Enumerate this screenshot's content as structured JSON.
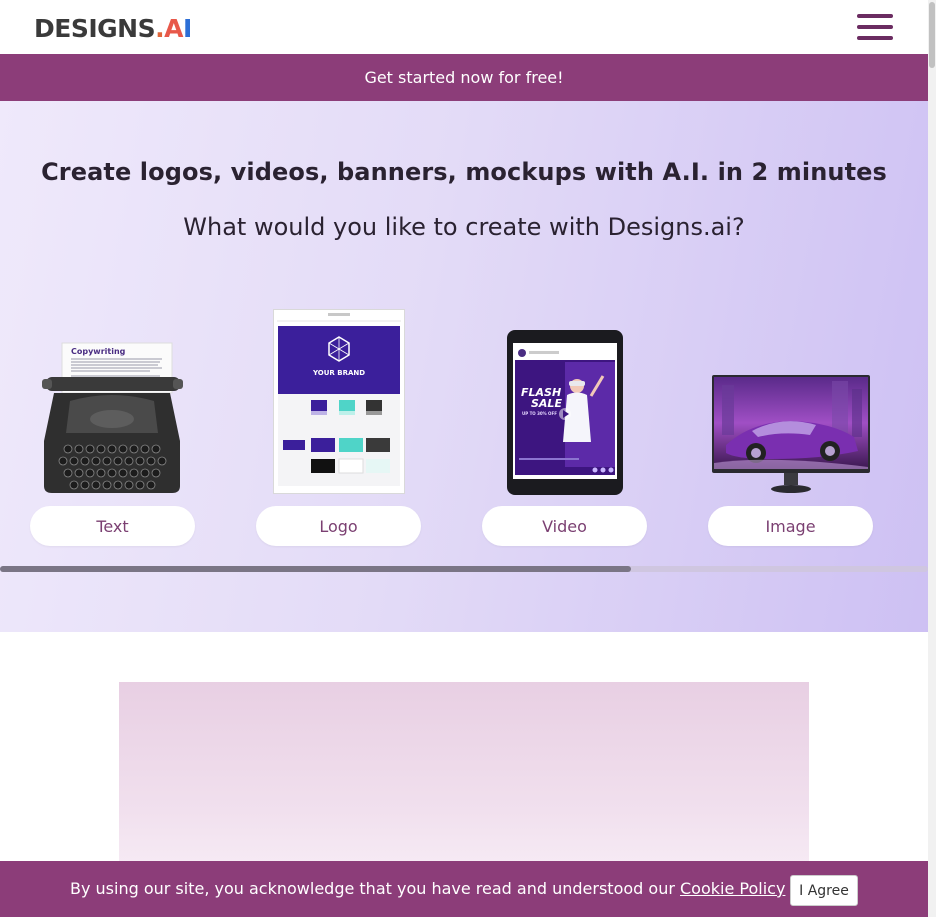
{
  "header": {
    "logo": {
      "main": "DESIGNS",
      "dot": ".",
      "a": "A",
      "i": "I"
    },
    "menu_icon": "hamburger-menu-icon"
  },
  "promo": {
    "text": "Get started now for free!"
  },
  "hero": {
    "title": "Create logos, videos, banners, mockups with A.I. in 2 minutes",
    "subtitle": "What would you like to create with Designs.ai?",
    "cards": [
      {
        "label": "Text",
        "image": "typewriter-image",
        "sheet_title": "Copywriting"
      },
      {
        "label": "Logo",
        "image": "brand-guide-image",
        "brand_text": "YOUR BRAND"
      },
      {
        "label": "Video",
        "image": "tablet-video-image",
        "flash": "FLASH",
        "sale": "SALE",
        "offer": "UP TO 30% OFF"
      },
      {
        "label": "Image",
        "image": "monitor-car-image"
      }
    ],
    "scroll_position": 0.68
  },
  "cookie": {
    "text": "By using our site, you acknowledge that you have read and understood our ",
    "link": "Cookie Policy",
    "button": "I Agree"
  },
  "colors": {
    "brand": "#8c3d79",
    "menu": "#6b2c61",
    "accent_logo_a": "#e8584a",
    "accent_logo_i": "#2d6fd6"
  }
}
